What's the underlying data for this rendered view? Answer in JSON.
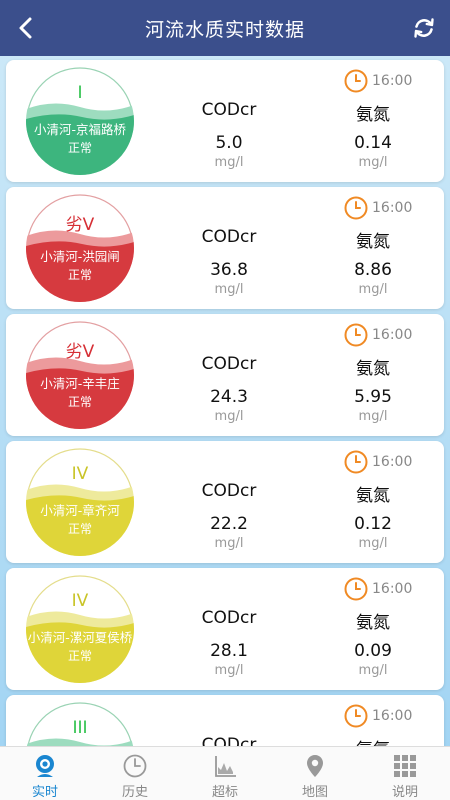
{
  "header": {
    "title": "河流水质实时数据"
  },
  "columns": {
    "cod_label": "CODcr",
    "nh_label": "氨氮",
    "unit": "mg/l"
  },
  "colors": {
    "green": "#3db57e",
    "red": "#d63a3f",
    "yellow": "#dfd539"
  },
  "stations": [
    {
      "grade": "I",
      "name": "小清河-京福路桥",
      "status": "正常",
      "time": "16:00",
      "cod": "5.0",
      "nh": "0.14",
      "level": "green"
    },
    {
      "grade": "劣V",
      "name": "小清河-洪园闸",
      "status": "正常",
      "time": "16:00",
      "cod": "36.8",
      "nh": "8.86",
      "level": "red"
    },
    {
      "grade": "劣V",
      "name": "小清河-辛丰庄",
      "status": "正常",
      "time": "16:00",
      "cod": "24.3",
      "nh": "5.95",
      "level": "red"
    },
    {
      "grade": "IV",
      "name": "小清河-章齐河",
      "status": "正常",
      "time": "16:00",
      "cod": "22.2",
      "nh": "0.12",
      "level": "yellow"
    },
    {
      "grade": "IV",
      "name": "小清河-漯河夏侯桥",
      "status": "正常",
      "time": "16:00",
      "cod": "28.1",
      "nh": "0.09",
      "level": "yellow"
    },
    {
      "grade": "III",
      "time": "16:00",
      "level": "green"
    }
  ],
  "tabs": [
    {
      "label": "实时",
      "icon": "webcam-icon",
      "active": true
    },
    {
      "label": "历史",
      "icon": "clock-icon",
      "active": false
    },
    {
      "label": "超标",
      "icon": "chart-icon",
      "active": false
    },
    {
      "label": "地图",
      "icon": "map-pin-icon",
      "active": false
    },
    {
      "label": "说明",
      "icon": "grid-icon",
      "active": false
    }
  ]
}
